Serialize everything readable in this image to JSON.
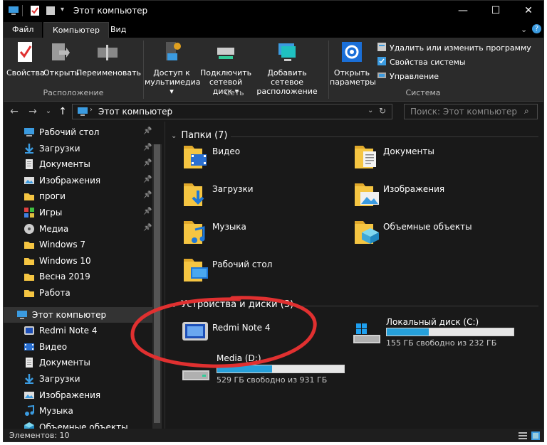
{
  "window": {
    "title": "Этот компьютер"
  },
  "tabs": {
    "file": "Файл",
    "computer": "Компьютер",
    "view": "Вид"
  },
  "ribbon": {
    "properties": "Свойства",
    "open": "Открыть",
    "rename": "Переименовать",
    "group_location": "Расположение",
    "media_access_1": "Доступ к",
    "media_access_2": "мультимедиа",
    "map_drive_1": "Подключить",
    "map_drive_2": "сетевой диск",
    "add_location_1": "Добавить сетевое",
    "add_location_2": "расположение",
    "group_network": "Сеть",
    "open_settings_1": "Открыть",
    "open_settings_2": "параметры",
    "uninstall": "Удалить или изменить программу",
    "system_props": "Свойства системы",
    "manage": "Управление",
    "group_system": "Система"
  },
  "address": {
    "path": "Этот компьютер",
    "search_placeholder": "Поиск: Этот компьютер"
  },
  "sidebar": {
    "items": [
      {
        "label": "Рабочий стол",
        "pinned": true,
        "icon": "desktop-icon"
      },
      {
        "label": "Загрузки",
        "pinned": true,
        "icon": "downloads-icon"
      },
      {
        "label": "Документы",
        "pinned": true,
        "icon": "documents-icon"
      },
      {
        "label": "Изображения",
        "pinned": true,
        "icon": "pictures-icon"
      },
      {
        "label": "проги",
        "pinned": true,
        "icon": "folder-icon"
      },
      {
        "label": "Игры",
        "pinned": true,
        "icon": "games-icon"
      },
      {
        "label": "Медиа",
        "pinned": true,
        "icon": "media-icon"
      },
      {
        "label": "Windows 7",
        "pinned": false,
        "icon": "folder-icon"
      },
      {
        "label": "Windows 10",
        "pinned": false,
        "icon": "folder-icon"
      },
      {
        "label": "Весна 2019",
        "pinned": false,
        "icon": "folder-icon"
      },
      {
        "label": "Работа",
        "pinned": false,
        "icon": "folder-icon"
      },
      {
        "label": "Этот компьютер",
        "pinned": false,
        "icon": "computer-icon"
      },
      {
        "label": "Redmi Note 4",
        "pinned": false,
        "icon": "phone-icon"
      },
      {
        "label": "Видео",
        "pinned": false,
        "icon": "videos-icon"
      },
      {
        "label": "Документы",
        "pinned": false,
        "icon": "documents-icon"
      },
      {
        "label": "Загрузки",
        "pinned": false,
        "icon": "downloads-icon"
      },
      {
        "label": "Изображения",
        "pinned": false,
        "icon": "pictures-icon"
      },
      {
        "label": "Музыка",
        "pinned": false,
        "icon": "music-icon"
      },
      {
        "label": "Объемные объекты",
        "pinned": false,
        "icon": "3d-objects-icon"
      }
    ]
  },
  "content": {
    "folders_header": "Папки (7)",
    "folders": [
      {
        "label": "Видео",
        "icon": "videos-folder-icon"
      },
      {
        "label": "Документы",
        "icon": "documents-folder-icon"
      },
      {
        "label": "Загрузки",
        "icon": "downloads-folder-icon"
      },
      {
        "label": "Изображения",
        "icon": "pictures-folder-icon"
      },
      {
        "label": "Музыка",
        "icon": "music-folder-icon"
      },
      {
        "label": "Объемные объекты",
        "icon": "3d-objects-folder-icon"
      },
      {
        "label": "Рабочий стол",
        "icon": "desktop-folder-icon"
      }
    ],
    "devices_header": "Устройства и диски (3)",
    "devices": {
      "phone": {
        "label": "Redmi Note 4"
      },
      "drive_c": {
        "label": "Локальный диск (C:)",
        "free_text": "155 ГБ свободно из 232 ГБ",
        "used_fraction": 0.33
      },
      "drive_d": {
        "label": "Media (D:)",
        "free_text": "529 ГБ свободно из 931 ГБ",
        "used_fraction": 0.43
      }
    }
  },
  "status": {
    "items": "Элементов: 10"
  },
  "colors": {
    "accent": "#26a0da",
    "annotation": "#e03030",
    "folder": "#f5c542"
  }
}
